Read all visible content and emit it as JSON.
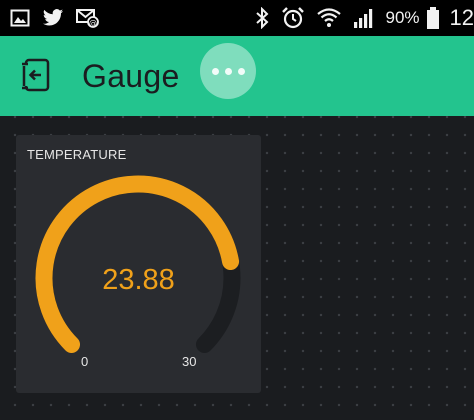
{
  "status_bar": {
    "battery": "90%",
    "time": "12",
    "icons": [
      "image-icon",
      "twitter-icon",
      "email-sync-icon",
      "bluetooth-icon",
      "alarm-icon",
      "wifi-icon",
      "signal-icon",
      "battery-icon"
    ]
  },
  "app_bar": {
    "title": "Gauge",
    "icons": [
      "exit-icon",
      "more-icon"
    ],
    "color": "#23c48e"
  },
  "widget": {
    "title": "TEMPERATURE",
    "value": "23.88",
    "value_number": 23.88,
    "min": "0",
    "max": "30",
    "min_number": 0,
    "max_number": 30,
    "accent_color": "#f0a11a",
    "track_color": "#1c1e21"
  }
}
